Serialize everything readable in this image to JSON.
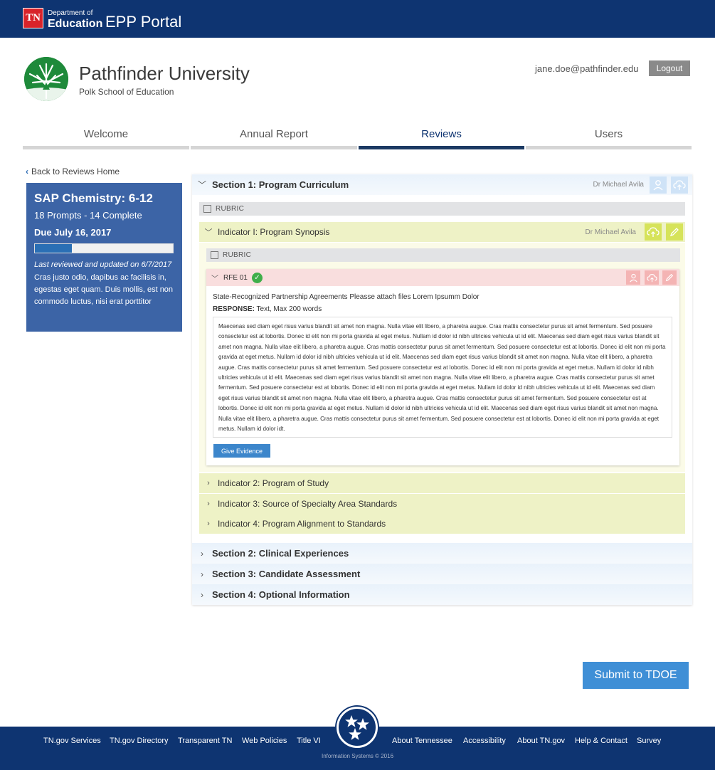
{
  "header": {
    "tn_badge": "TN",
    "dept_line1": "Department of",
    "dept_line2": "Education",
    "portal_title": "EPP Portal"
  },
  "university": {
    "name": "Pathfinder University",
    "school": "Polk School of Education"
  },
  "user": {
    "email": "jane.doe@pathfinder.edu",
    "logout_label": "Logout"
  },
  "tabs": [
    {
      "label": "Welcome",
      "active": false
    },
    {
      "label": "Annual Report",
      "active": false
    },
    {
      "label": "Reviews",
      "active": true
    },
    {
      "label": "Users",
      "active": false
    }
  ],
  "back_link": "Back to Reviews Home",
  "sidebar": {
    "title": "SAP Chemistry: 6-12",
    "prompts": "18 Prompts - 14 Complete",
    "due": "Due July 16, 2017",
    "progress_fraction": 0.27,
    "updated": "Last reviewed and updated on 6/7/2017",
    "text": "Cras justo odio, dapibus ac facilisis in, egestas eget quam. Duis mollis, est non commodo luctus, nisi erat porttitor"
  },
  "sections": [
    {
      "title": "Section 1: Program Curriculum",
      "reviewer": "Dr Michael Avila"
    },
    {
      "title": "Section 2: Clinical Experiences"
    },
    {
      "title": "Section 3: Candidate Assessment"
    },
    {
      "title": "Section 4: Optional Information"
    }
  ],
  "rubric_label": "RUBRIC",
  "indicators": [
    {
      "title": "Indicator I: Program Synopsis",
      "reviewer": "Dr Michael Avila"
    },
    {
      "title": "Indicator 2: Program of Study"
    },
    {
      "title": "Indicator 3: Source of Specialty Area Standards"
    },
    {
      "title": "Indicator 4: Program Alignment to Standards"
    }
  ],
  "rfe": {
    "title": "RFE 01",
    "prompt": "State-Recognized Partnership Agreements Pleasse attach files Lorem Ipsumm Dolor",
    "response_label": "RESPONSE:",
    "response_spec": "Text, Max 200 words",
    "response_text": "Maecenas sed diam eget risus varius blandit sit amet non magna. Nulla vitae elit libero, a pharetra augue. Cras mattis consectetur purus sit amet fermentum. Sed posuere consectetur est at lobortis. Donec id elit non mi porta gravida at eget metus. Nullam id dolor id nibh ultricies vehicula ut id elit.  Maecenas sed diam eget risus varius blandit sit amet non magna. Nulla vitae elit libero, a pharetra augue. Cras mattis consectetur purus sit amet fermentum. Sed posuere consectetur est at lobortis. Donec id elit non mi porta gravida at eget metus. Nullam id dolor id nibh ultricies vehicula ut id elit.  Maecenas sed diam eget risus varius blandit sit amet non magna. Nulla vitae elit libero, a pharetra augue. Cras mattis consectetur purus sit amet fermentum. Sed posuere consectetur est at lobortis. Donec id elit non mi porta gravida at eget metus. Nullam id dolor id nibh ultricies vehicula ut id elit.  Maecenas sed diam eget risus varius blandit sit amet non magna. Nulla vitae elit libero, a pharetra augue. Cras mattis consectetur purus sit amet fermentum. Sed posuere consectetur est at lobortis. Donec id elit non mi porta gravida at eget metus. Nullam id dolor id nibh ultricies vehicula ut id elit.  Maecenas sed diam eget risus varius blandit sit amet non magna. Nulla vitae elit libero, a pharetra augue. Cras mattis consectetur purus sit amet fermentum. Sed posuere consectetur est at lobortis. Donec id elit non mi porta gravida at eget metus. Nullam id dolor id nibh ultricies vehicula ut id elit.  Maecenas sed diam eget risus varius blandit sit amet non magna. Nulla vitae elit libero, a pharetra augue. Cras mattis consectetur purus sit amet fermentum. Sed posuere consectetur est at lobortis. Donec id elit non mi porta gravida at eget metus. Nullam id dolor idt.",
    "evidence_label": "Give Evidence"
  },
  "submit_label": "Submit to TDOE",
  "footer": {
    "links_left": [
      "TN.gov Services",
      "TN.gov Directory",
      "Transparent TN",
      "Web Policies",
      "Title VI"
    ],
    "links_right": [
      "About Tennessee",
      "Accessibility",
      "About TN.gov",
      "Help & Contact",
      "Survey"
    ],
    "copyright": "Information Systems © 2016"
  },
  "colors": {
    "navy": "#0e3471",
    "side_card": "#3c64a6",
    "indicator_bg": "#eef2c6",
    "rfe_bg": "#f9dede",
    "submit": "#3f8fd6"
  }
}
